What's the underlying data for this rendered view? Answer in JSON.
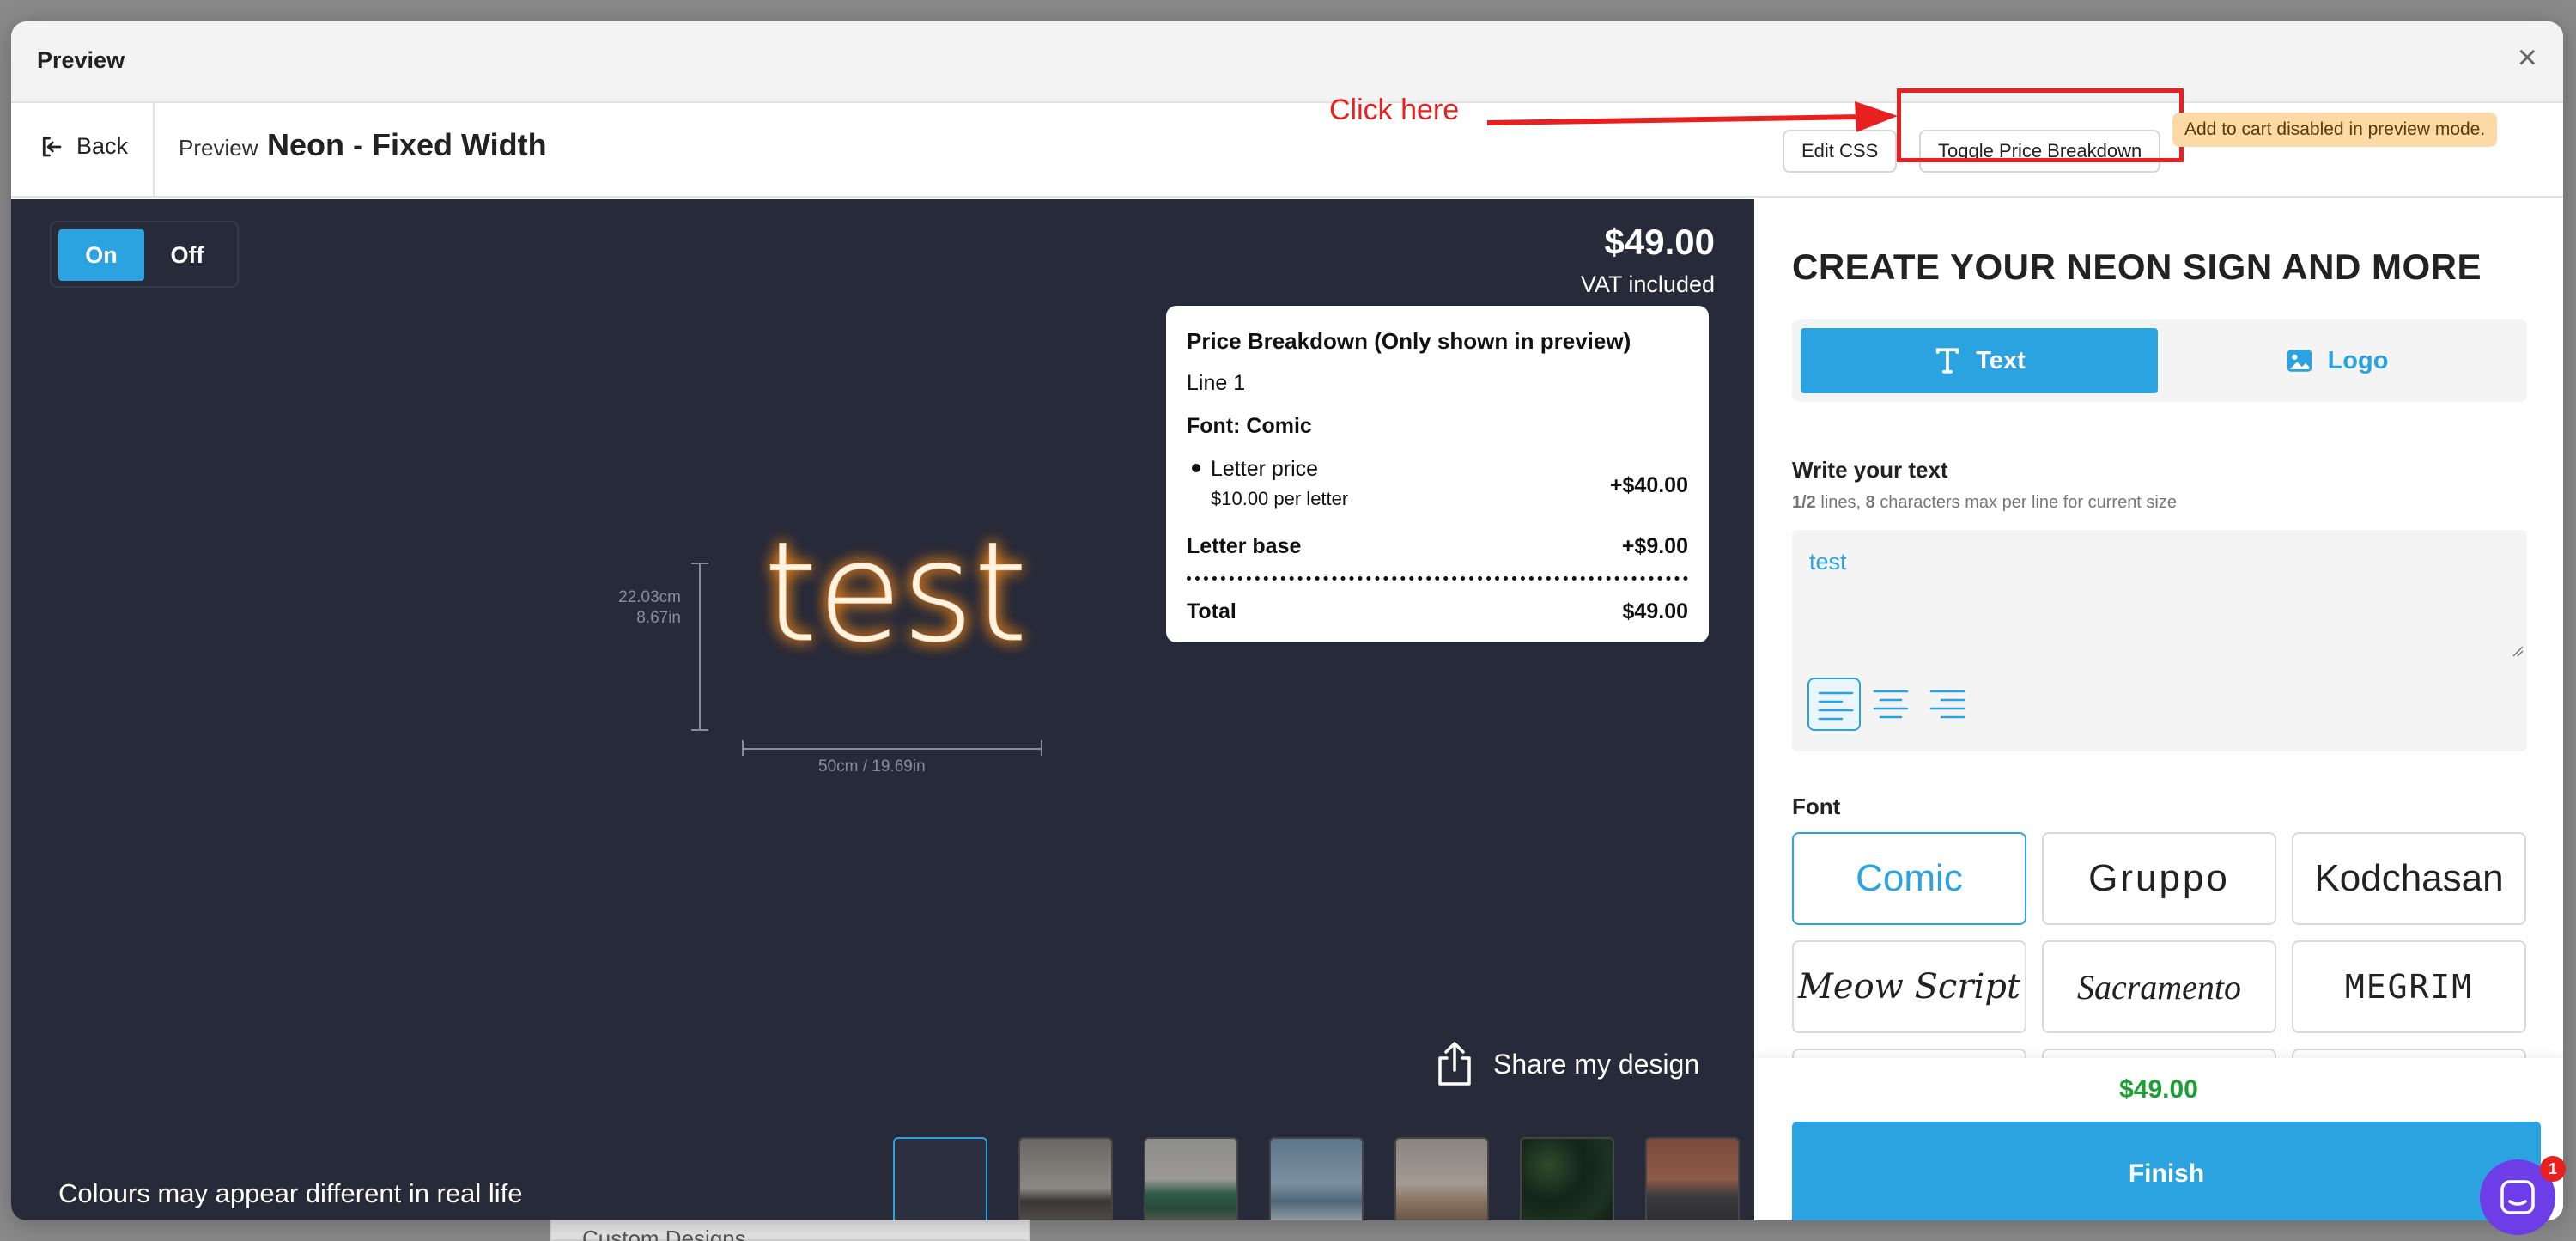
{
  "background_page": {
    "label": "Custom Designs"
  },
  "modal": {
    "title": "Preview",
    "close_glyph": "×"
  },
  "toolbar": {
    "back_label": "Back",
    "breadcrumb": "Preview",
    "page_title": "Neon - Fixed Width",
    "edit_css_label": "Edit CSS",
    "toggle_price_label": "Toggle Price Breakdown",
    "cart_notice": "Add to cart disabled in preview mode."
  },
  "annotation": {
    "text": "Click here",
    "color": "#e8201f"
  },
  "stage": {
    "toggle_on": "On",
    "toggle_off": "Off",
    "price": "$49.00",
    "vat": "VAT included",
    "neon_text": "test",
    "neon_color": "#ff8a1c",
    "height_cm": "22.03cm",
    "height_in": "8.67in",
    "width_label": "50cm / 19.69in",
    "share_label": "Share my design",
    "disclaimer": "Colours may appear different in real life",
    "thumbnails": [
      "none",
      "concrete-wall",
      "green-sofa",
      "blue-room",
      "beige-sofa",
      "hedge",
      "brick-wall"
    ]
  },
  "breakdown": {
    "heading": "Price Breakdown (Only shown in preview)",
    "line": "Line 1",
    "font": "Font: Comic",
    "letter_price_label": "Letter price",
    "letter_price_sub": "$10.00 per letter",
    "letter_price_value": "+$40.00",
    "letter_base_label": "Letter base",
    "letter_base_value": "+$9.00",
    "total_label": "Total",
    "total_value": "$49.00"
  },
  "panel": {
    "heading": "CREATE YOUR NEON SIGN AND MORE",
    "tab_text": "Text",
    "tab_logo": "Logo",
    "write_label": "Write your text",
    "help_lines": "1/2",
    "help_mid": " lines, ",
    "help_chars": "8",
    "help_end": " characters max per line for current size",
    "text_value": "test",
    "font_label": "Font",
    "fonts": [
      "Comic",
      "Gruppo",
      "Kodchasan",
      "Meow Script",
      "Sacramento",
      "MEGRIM"
    ],
    "footer_price": "$49.00",
    "finish_label": "Finish"
  },
  "chat": {
    "badge": "1"
  },
  "colors": {
    "accent": "#2ba3e0",
    "stage_bg": "#272a38",
    "price_green": "#1aa033",
    "notice_bg": "#fdd9a5"
  }
}
